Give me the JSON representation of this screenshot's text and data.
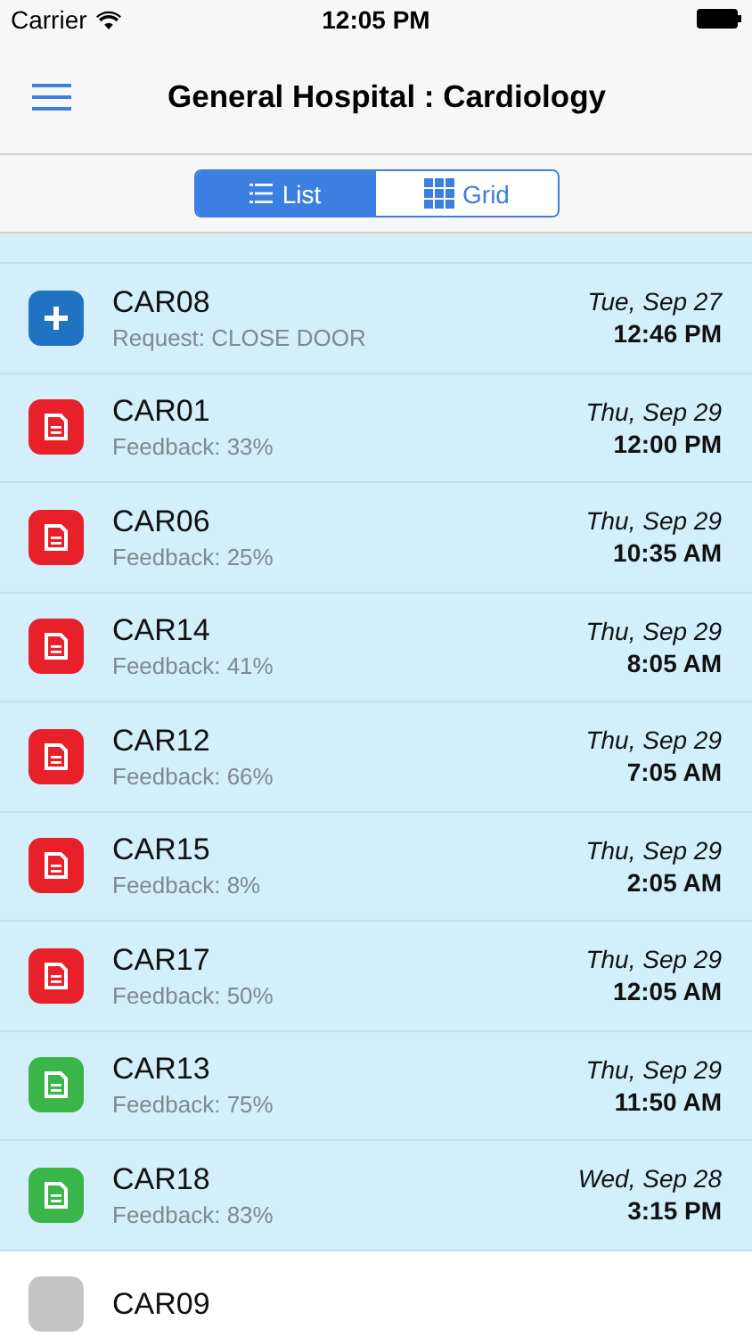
{
  "status_bar": {
    "carrier": "Carrier",
    "time": "12:05 PM"
  },
  "nav": {
    "title": "General Hospital : Cardiology"
  },
  "view_switch": [
    {
      "label": "List",
      "kind": "list",
      "selected": true
    },
    {
      "label": "Grid",
      "kind": "grid",
      "selected": false
    }
  ],
  "rows": [
    {
      "name": "CAR08",
      "kind": "request",
      "color": "#2272c3",
      "detail": "Request: CLOSE DOOR",
      "date": "Tue, Sep 27",
      "time": "12:46 PM",
      "highlighted": true
    },
    {
      "name": "CAR01",
      "kind": "feedback",
      "color": "#e8202a",
      "detail": "Feedback: 33%",
      "date": "Thu, Sep 29",
      "time": "12:00 PM",
      "highlighted": true
    },
    {
      "name": "CAR06",
      "kind": "feedback",
      "color": "#e8202a",
      "detail": "Feedback: 25%",
      "date": "Thu, Sep 29",
      "time": "10:35 AM",
      "highlighted": true
    },
    {
      "name": "CAR14",
      "kind": "feedback",
      "color": "#e8202a",
      "detail": "Feedback: 41%",
      "date": "Thu, Sep 29",
      "time": "8:05 AM",
      "highlighted": true
    },
    {
      "name": "CAR12",
      "kind": "feedback",
      "color": "#e8202a",
      "detail": "Feedback: 66%",
      "date": "Thu, Sep 29",
      "time": "7:05 AM",
      "highlighted": true
    },
    {
      "name": "CAR15",
      "kind": "feedback",
      "color": "#e8202a",
      "detail": "Feedback: 8%",
      "date": "Thu, Sep 29",
      "time": "2:05 AM",
      "highlighted": true
    },
    {
      "name": "CAR17",
      "kind": "feedback",
      "color": "#e8202a",
      "detail": "Feedback: 50%",
      "date": "Thu, Sep 29",
      "time": "12:05 AM",
      "highlighted": true
    },
    {
      "name": "CAR13",
      "kind": "feedback",
      "color": "#3ab54a",
      "detail": "Feedback: 75%",
      "date": "Thu, Sep 29",
      "time": "11:50 AM",
      "highlighted": true
    },
    {
      "name": "CAR18",
      "kind": "feedback",
      "color": "#3ab54a",
      "detail": "Feedback: 83%",
      "date": "Wed, Sep 28",
      "time": "3:15 PM",
      "highlighted": true
    },
    {
      "name": "CAR09",
      "kind": "empty",
      "color": "#c4c4c4",
      "highlighted": false
    }
  ]
}
